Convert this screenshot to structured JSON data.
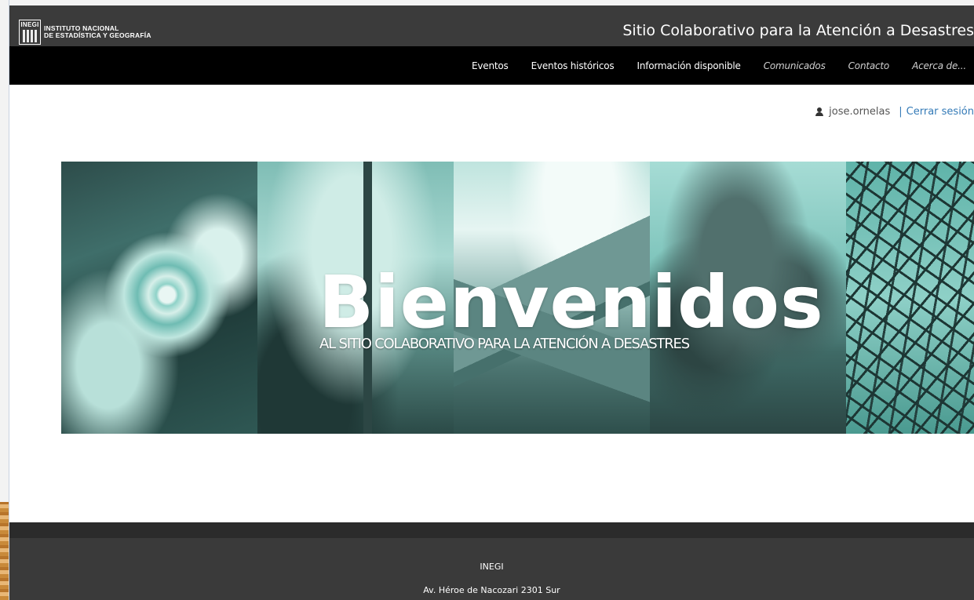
{
  "header": {
    "logo_abbr": "INEGI",
    "logo_line1": "INSTITUTO NACIONAL",
    "logo_line2": "DE ESTADÍSTICA Y GEOGRAFÍA",
    "site_title": "Sitio Colaborativo para la Atención a Desastres"
  },
  "nav": {
    "items": [
      {
        "label": "Eventos"
      },
      {
        "label": "Eventos históricos"
      },
      {
        "label": "Información disponible"
      },
      {
        "label": "Comunicados"
      },
      {
        "label": "Contacto"
      },
      {
        "label": "Acerca de..."
      }
    ]
  },
  "user": {
    "icon": "user-icon",
    "username": "jose.ornelas",
    "separator": "|",
    "logout_label": "Cerrar sesión"
  },
  "hero": {
    "title": "Bienvenidos",
    "subtitle": "AL SITIO COLABORATIVO PARA LA ATENCIÓN A DESASTRES"
  },
  "footer": {
    "org": "INEGI",
    "address": "Av. Héroe de Nacozari 2301 Sur"
  },
  "colors": {
    "header_bg": "#3b3b3b",
    "nav_bg": "#000000",
    "link": "#337ab7",
    "footer_bg": "#3a3a3a",
    "hero_tint": "#5fb3a9"
  }
}
